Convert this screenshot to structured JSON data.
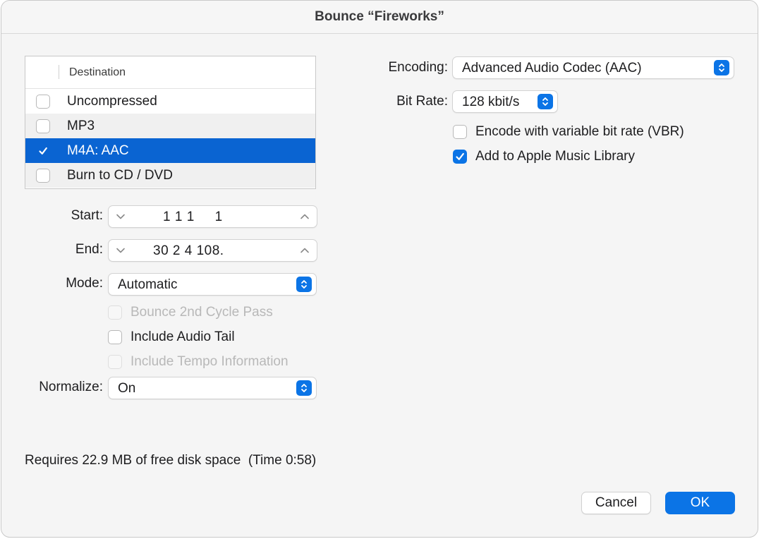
{
  "window": {
    "title": "Bounce “Fireworks”"
  },
  "destination": {
    "header": "Destination",
    "items": [
      {
        "label": "Uncompressed",
        "checked": false
      },
      {
        "label": "MP3",
        "checked": false
      },
      {
        "label": "M4A: AAC",
        "checked": true,
        "selected": true
      },
      {
        "label": "Burn to CD / DVD",
        "checked": false
      }
    ]
  },
  "range": {
    "start_label": "Start:",
    "start_value": "1 1 1     1",
    "end_label": "End:",
    "end_value": "30 2 4 108."
  },
  "mode": {
    "label": "Mode:",
    "value": "Automatic"
  },
  "options": {
    "bounce_cycle": {
      "label": "Bounce 2nd Cycle Pass",
      "checked": false,
      "enabled": false
    },
    "audio_tail": {
      "label": "Include Audio Tail",
      "checked": false,
      "enabled": true
    },
    "tempo_info": {
      "label": "Include Tempo Information",
      "checked": false,
      "enabled": false
    }
  },
  "normalize": {
    "label": "Normalize:",
    "value": "On"
  },
  "encoding": {
    "label": "Encoding:",
    "value": "Advanced Audio Codec (AAC)"
  },
  "bitrate": {
    "label": "Bit Rate:",
    "value": "128 kbit/s"
  },
  "vbr": {
    "label": "Encode with variable bit rate (VBR)",
    "checked": false
  },
  "apple_music": {
    "label": "Add to Apple Music Library",
    "checked": true
  },
  "status": {
    "text": "Requires 22.9 MB of free disk space  (Time 0:58)"
  },
  "buttons": {
    "cancel": "Cancel",
    "ok": "OK"
  },
  "colors": {
    "accent": "#0b74e6",
    "selection": "#0a64d2"
  },
  "icons": {
    "checkmark": "checkmark-icon",
    "stepper_down": "chevron-down-icon",
    "stepper_up": "chevron-up-icon",
    "popup_arrows": "up-down-chevrons-icon"
  }
}
